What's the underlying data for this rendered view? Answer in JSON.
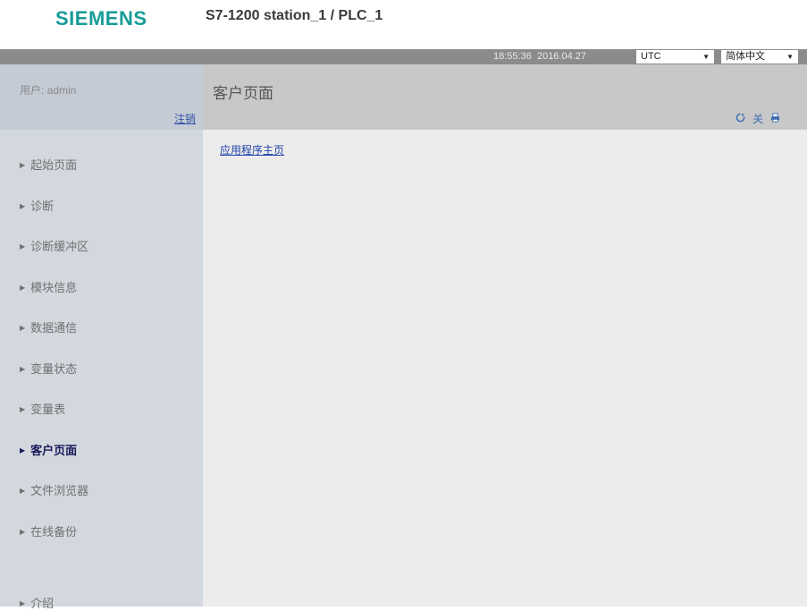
{
  "header": {
    "logo": "SIEMENS",
    "station": "S7-1200 station_1 / PLC_1"
  },
  "topbar": {
    "time": "18:55:36",
    "date": "2016.04.27",
    "timezone": "UTC",
    "language": "简体中文"
  },
  "user": {
    "label": "用户: admin",
    "logout": "注销"
  },
  "nav": {
    "items": [
      {
        "label": "起始页面"
      },
      {
        "label": "诊断"
      },
      {
        "label": "诊断缓冲区"
      },
      {
        "label": "模块信息"
      },
      {
        "label": "数据通信"
      },
      {
        "label": "变量状态"
      },
      {
        "label": "变量表"
      },
      {
        "label": "客户页面",
        "active": true
      },
      {
        "label": "文件浏览器"
      },
      {
        "label": "在线备份"
      },
      {
        "label": "介绍"
      }
    ]
  },
  "page": {
    "title": "客户页面",
    "link": "应用程序主页"
  },
  "icons": {
    "refresh": "refresh-icon",
    "off": "关",
    "print": "print-icon"
  },
  "colors": {
    "brand": "#179c98",
    "sidebar": "#d3d7de",
    "topbar": "#8b8b8b"
  }
}
